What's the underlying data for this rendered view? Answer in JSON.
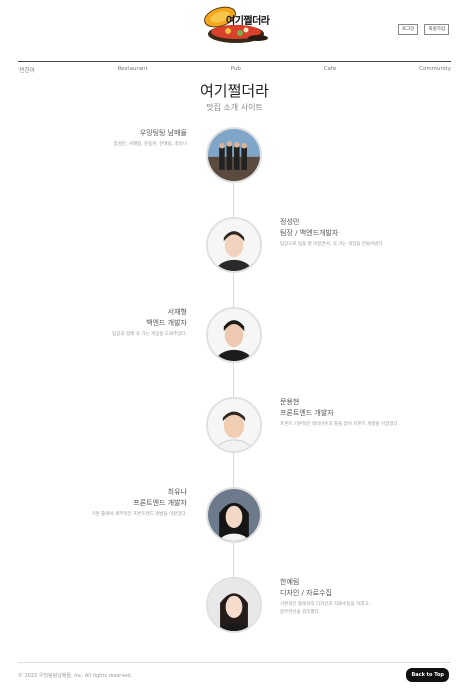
{
  "header": {
    "logo_text": "여기쩔더라",
    "buttons": [
      "로그인",
      "회원가입"
    ]
  },
  "nav": {
    "items": [
      "'찐한어",
      "Restaurant",
      "Pub",
      "Cafe",
      "Community"
    ]
  },
  "hero": {
    "title": "여기쩔더라",
    "subtitle": "맛집 소개 사이트"
  },
  "team": [
    {
      "name": "우밍팅팅 남매들",
      "role": "",
      "desc": [
        "정성민, 서재형, 문용현, 한예림, 최유나"
      ],
      "side": "left"
    },
    {
      "name": "정성민",
      "role": "팀장 / 백엔드개발자",
      "desc": [
        "팀장으로 팀을 잘 이끌면서, 꼭 가는 게임을 만들어냈다."
      ],
      "side": "right"
    },
    {
      "name": "서재형",
      "role": "백엔드 개발자",
      "desc": [
        "팀장과 함께 꼭 가는 게임을 도와주었다."
      ],
      "side": "left"
    },
    {
      "name": "문용현",
      "role": "프론트엔드 개발자",
      "desc": [
        "프론트 기본적인 레이아웃과 틀을 잡아 프론트 개발을 이끌었다."
      ],
      "side": "right"
    },
    {
      "name": "최유나",
      "role": "프론트엔드 개발자",
      "desc": [
        "기본 틀에서 세부적인 프론트엔드 개발을 이끌었다."
      ],
      "side": "left"
    },
    {
      "name": "한예림",
      "role": "디자인 / 자료수집",
      "desc": [
        "기본적인 틀에서의 디자인과 자료수집을 하였고,",
        "중부연산을 검토했다."
      ],
      "side": "right"
    }
  ],
  "footer": {
    "copyright": "© 2022 우밍팅팅남매들, Inc. All rights reserved.",
    "back_to_top": "Back to Top"
  }
}
